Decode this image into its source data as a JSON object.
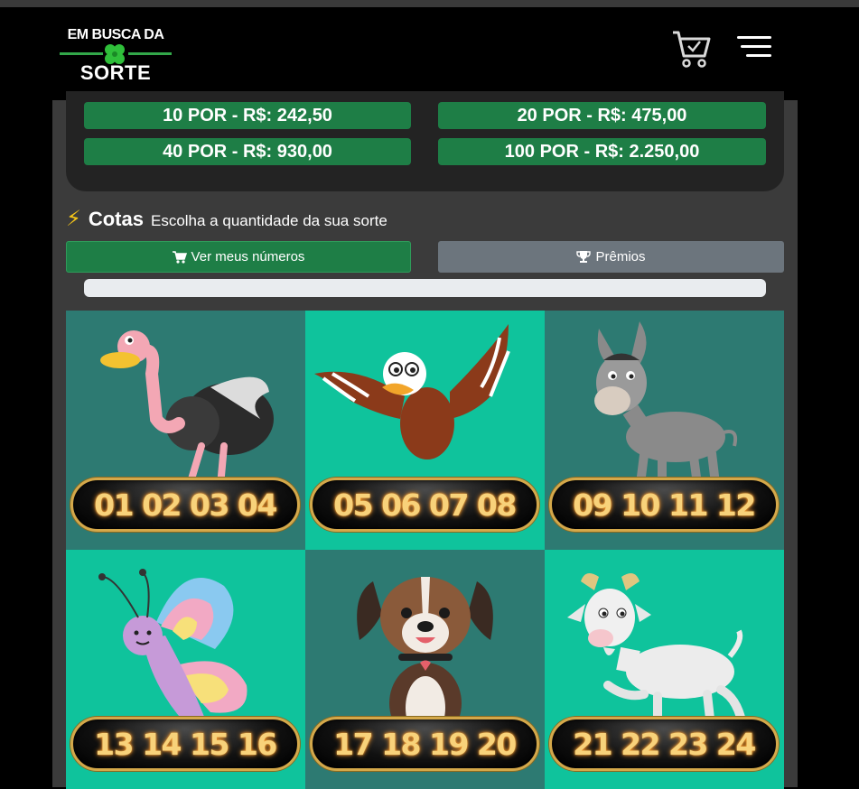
{
  "header": {
    "logo_line1": "EM BUSCA DA",
    "logo_line2": "SORTE",
    "icons": [
      "cart-icon",
      "hamburger-menu-icon",
      "clover-icon"
    ]
  },
  "packages": [
    {
      "label": "10 POR - R$: 242,50"
    },
    {
      "label": "20 POR - R$: 475,00"
    },
    {
      "label": "40 POR - R$: 930,00"
    },
    {
      "label": "100 POR - R$: 2.250,00"
    }
  ],
  "cotas": {
    "icon": "lightning-icon",
    "title": "Cotas",
    "subtitle": "Escolha a quantidade da sua sorte"
  },
  "buttons": {
    "my_numbers": "Ver meus números",
    "prizes": "Prêmios"
  },
  "progress": {
    "fraction": 0
  },
  "colors": {
    "brand_green": "#1e7e46",
    "tile_dark": "#2d7a72",
    "tile_light": "#0fc39c",
    "number_gold": "#f8d27a"
  },
  "tiles": [
    {
      "animal": "ostrich",
      "numbers": "01 02 03 04"
    },
    {
      "animal": "eagle",
      "numbers": "05 06 07 08"
    },
    {
      "animal": "donkey",
      "numbers": "09 10 11 12"
    },
    {
      "animal": "butterfly",
      "numbers": "13 14 15 16"
    },
    {
      "animal": "dog",
      "numbers": "17 18 19 20"
    },
    {
      "animal": "goat",
      "numbers": "21 22 23 24"
    }
  ]
}
